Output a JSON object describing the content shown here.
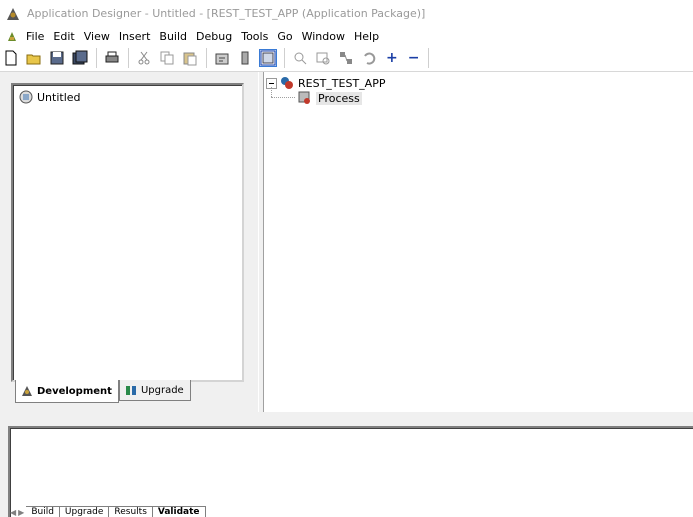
{
  "window": {
    "title": "Application Designer - Untitled - [REST_TEST_APP (Application Package)]"
  },
  "menu": [
    "File",
    "Edit",
    "View",
    "Insert",
    "Build",
    "Debug",
    "Tools",
    "Go",
    "Window",
    "Help"
  ],
  "toolbar": {
    "icons": [
      "new-icon",
      "open-icon",
      "save-icon",
      "save-all-icon",
      "print-icon",
      "cut-icon",
      "copy-icon",
      "paste-icon",
      "properties-icon",
      "find-icon",
      "project-workspace-icon",
      "find-definition-icon",
      "validate-icon",
      "compare-icon",
      "undo-icon"
    ],
    "plus": "+",
    "minus": "−"
  },
  "project": {
    "item": "Untitled",
    "tabs": [
      "Development",
      "Upgrade"
    ]
  },
  "tree": {
    "root": "REST_TEST_APP",
    "child": "Process"
  },
  "output": {
    "tabs": [
      "Build",
      "Upgrade",
      "Results",
      "Validate"
    ]
  },
  "colors": {
    "accent": "#1b3fa6",
    "selection": "#cfe3ff"
  }
}
